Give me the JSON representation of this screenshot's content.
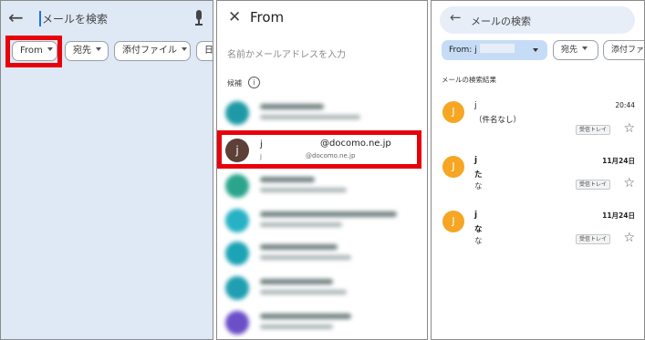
{
  "panel1": {
    "search_placeholder": "メールを検索",
    "chips": [
      {
        "label": "From"
      },
      {
        "label": "宛先"
      },
      {
        "label": "添付ファイル"
      },
      {
        "label": "日"
      }
    ]
  },
  "panel2": {
    "title": "From",
    "input_placeholder": "名前かメールアドレスを入力",
    "candidates_label": "候補",
    "contact": {
      "avatar_letter": "j",
      "name": "j",
      "email": "@docomo.ne.jp",
      "sub_name": "j",
      "sub_email": "@docomo.ne.jp"
    }
  },
  "panel3": {
    "search_text": "メールの検索",
    "chips": [
      {
        "label": "From: j"
      },
      {
        "label": "宛先"
      },
      {
        "label": "添付ファ"
      }
    ],
    "section_label": "メールの検索結果",
    "emails": [
      {
        "avatar": "J",
        "sender": "j",
        "time": "20:44",
        "subject": "（件名なし）",
        "snippet": "",
        "label": "受信トレイ"
      },
      {
        "avatar": "J",
        "sender": "j",
        "time": "11月24日",
        "subject": "た",
        "snippet": "な",
        "label": "受信トレイ"
      },
      {
        "avatar": "J",
        "sender": "j",
        "time": "11月24日",
        "subject": "な",
        "snippet": "な",
        "label": "受信トレイ"
      }
    ]
  },
  "colors": {
    "highlight": "#e8000b",
    "panel1_bg": "#dfe9f5",
    "chip_selected": "#c6dcf6",
    "avatar_orange": "#f6a623",
    "avatar_brown": "#5d4037"
  }
}
